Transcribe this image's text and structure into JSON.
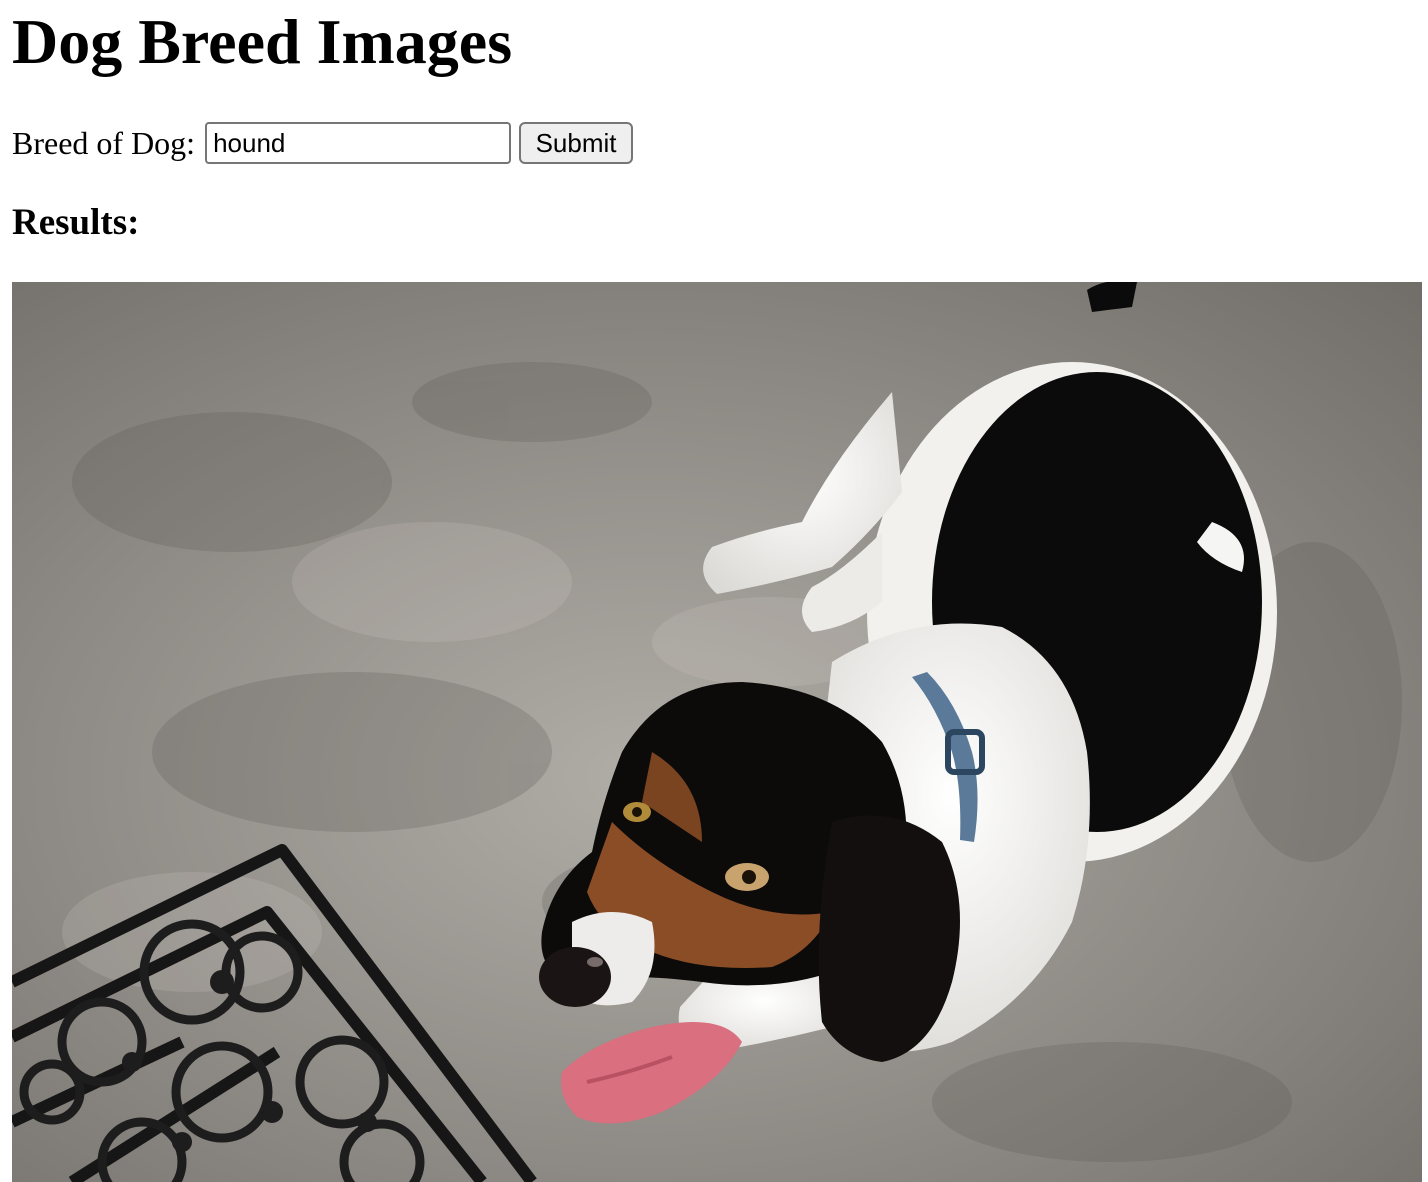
{
  "page": {
    "title": "Dog Breed Images"
  },
  "form": {
    "label": "Breed of Dog:",
    "input_value": "hound",
    "submit_label": "Submit"
  },
  "results": {
    "heading": "Results:",
    "image_subject": "basset hound lying on concrete floor next to a wrought-iron door mat"
  },
  "colors": {
    "button_bg": "#efefef",
    "input_border": "#767676"
  }
}
